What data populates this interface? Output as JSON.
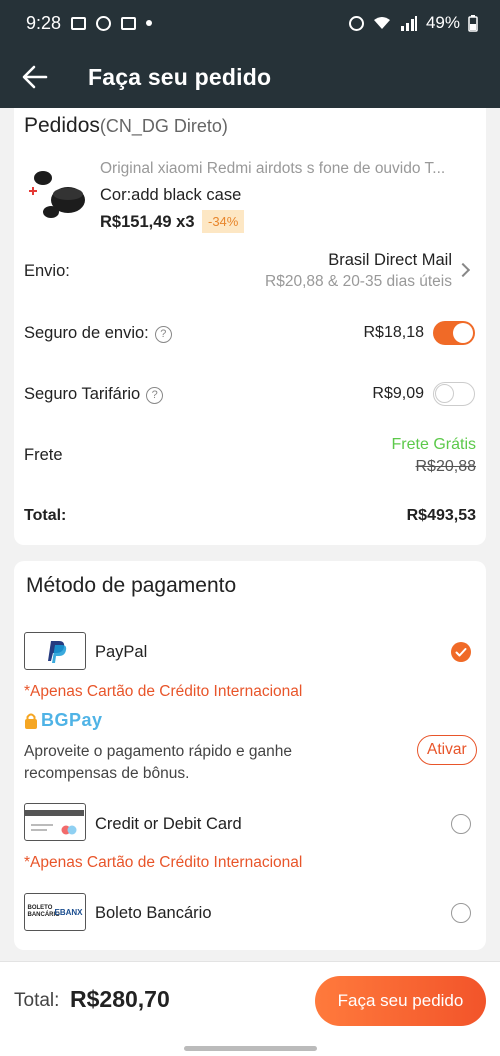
{
  "status_bar": {
    "time": "9:28",
    "battery": "49%"
  },
  "header": {
    "title": "Faça seu pedido"
  },
  "order": {
    "heading": "Pedidos",
    "seller": "(CN_DG Direto)",
    "product": {
      "name": "Original xiaomi Redmi airdots s fone de ouvido T...",
      "variant": "Cor:add black case",
      "price": "R$151,49 x3",
      "discount": "-34%"
    },
    "shipping": {
      "label": "Envio:",
      "method": "Brasil Direct Mail",
      "detail": "R$20,88 & 20-35 dias úteis"
    },
    "shipping_insurance": {
      "label": "Seguro de envio:",
      "value": "R$18,18",
      "enabled": true
    },
    "tariff_insurance": {
      "label": "Seguro Tarifário",
      "value": "R$9,09",
      "enabled": false
    },
    "freight": {
      "label": "Frete",
      "value": "Frete Grátis",
      "original": "R$20,88"
    },
    "total": {
      "label": "Total:",
      "value": "R$493,53"
    }
  },
  "payment": {
    "heading": "Método de pagamento",
    "paypal": {
      "label": "PayPal",
      "selected": true,
      "note": "*Apenas Cartão de Crédito  Internacional"
    },
    "bgpay": {
      "logo_text": "BGPay",
      "text": "Aproveite o pagamento rápido e ganhe recompensas de bônus.",
      "button": "Ativar"
    },
    "card": {
      "label": "Credit or Debit Card",
      "selected": false,
      "note": "*Apenas Cartão de Crédito  Internacional"
    },
    "boleto": {
      "label": "Boleto Bancário",
      "selected": false,
      "logo_text": "BOLETO BANCÁRIO",
      "logo_brand": "EBANX"
    }
  },
  "footer": {
    "total_label": "Total:",
    "total_value": "R$280,70",
    "cta": "Faça seu pedido"
  },
  "colors": {
    "accent": "#f06a27",
    "free_shipping": "#5cc94a",
    "note": "#e8552a",
    "appbar": "#263238"
  }
}
